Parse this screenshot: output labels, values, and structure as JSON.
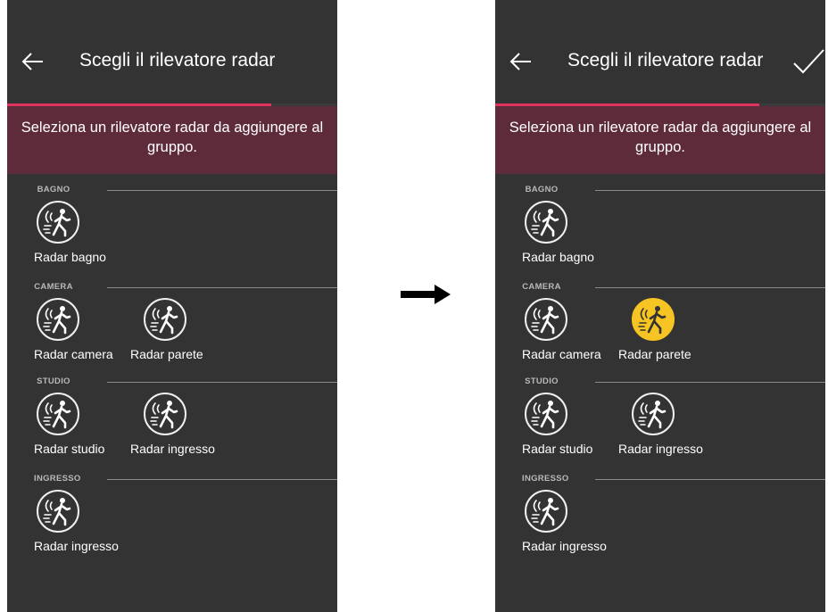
{
  "screens": {
    "before": {
      "title": "Scegli il rilevatore radar",
      "show_confirm": false,
      "progress_percent": 80,
      "instruction": "Seleziona un rilevatore radar da aggiungere al gruppo.",
      "rooms": [
        {
          "name": "BAGNO",
          "devices": [
            {
              "label": "Radar bagno",
              "selected": false
            }
          ]
        },
        {
          "name": "CAMERA",
          "devices": [
            {
              "label": "Radar camera",
              "selected": false
            },
            {
              "label": "Radar parete",
              "selected": false
            }
          ]
        },
        {
          "name": "STUDIO",
          "devices": [
            {
              "label": "Radar studio",
              "selected": false
            },
            {
              "label": "Radar ingresso",
              "selected": false
            }
          ]
        },
        {
          "name": "INGRESSO",
          "devices": [
            {
              "label": "Radar ingresso",
              "selected": false
            }
          ]
        }
      ]
    },
    "after": {
      "title": "Scegli il rilevatore radar",
      "show_confirm": true,
      "progress_percent": 80,
      "instruction": "Seleziona un rilevatore radar da aggiungere al gruppo.",
      "rooms": [
        {
          "name": "BAGNO",
          "devices": [
            {
              "label": "Radar bagno",
              "selected": false
            }
          ]
        },
        {
          "name": "CAMERA",
          "devices": [
            {
              "label": "Radar camera",
              "selected": false
            },
            {
              "label": "Radar parete",
              "selected": true
            }
          ]
        },
        {
          "name": "STUDIO",
          "devices": [
            {
              "label": "Radar studio",
              "selected": false
            },
            {
              "label": "Radar ingresso",
              "selected": false
            }
          ]
        },
        {
          "name": "INGRESSO",
          "devices": [
            {
              "label": "Radar ingresso",
              "selected": false
            }
          ]
        }
      ]
    }
  },
  "icons": {
    "back": "arrow-left-icon",
    "confirm": "checkmark-icon",
    "device": "radar-motion-sensor-icon",
    "transition": "arrow-right-icon"
  },
  "colors": {
    "screen_bg": "#333333",
    "progress_accent": "#e0325f",
    "banner_bg": "#5e2b3b",
    "selected_icon": "#f6c423",
    "divider": "#8a8a8a"
  }
}
